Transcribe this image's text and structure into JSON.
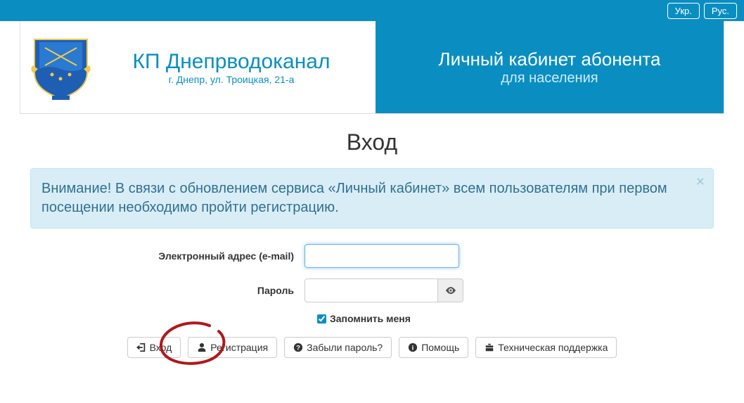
{
  "lang": {
    "ukr": "Укр.",
    "rus": "Рус."
  },
  "company": {
    "title": "КП Днепрводоканал",
    "address": "г. Днепр, ул. Троицкая, 21-а"
  },
  "cabinet": {
    "title": "Личный кабинет абонента",
    "subtitle": "для населения"
  },
  "page_title": "Вход",
  "alert_text": "Внимание! В связи с обновлением сервиса «Личный кабинет» всем пользователям при первом посещении необходимо пройти регистрацию.",
  "form": {
    "email_label": "Электронный адрес (e-mail)",
    "email_value": "",
    "password_label": "Пароль",
    "password_value": "",
    "remember_label": "Запомнить меня",
    "remember_checked": true
  },
  "buttons": {
    "login": "Вход",
    "register": "Регистрация",
    "forgot": "Забыли пароль?",
    "help": "Помощь",
    "support": "Техническая поддержка"
  }
}
